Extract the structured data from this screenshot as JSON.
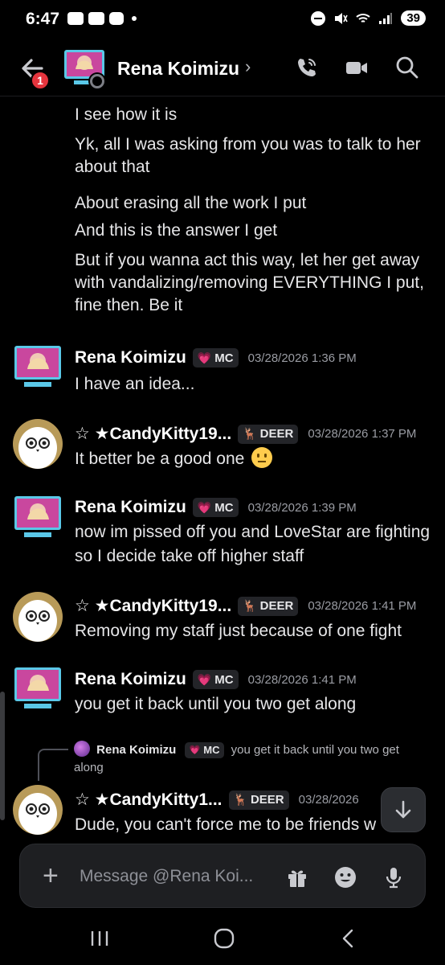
{
  "status_bar": {
    "time": "6:47",
    "battery": "39"
  },
  "header": {
    "back_badge": "1",
    "contact_name": "Rena Koimizu",
    "chevron": "›"
  },
  "chat": {
    "continued_lines": [
      "I see how it is",
      "Yk, all I was asking from you was to talk to her about that",
      "About erasing all the work I put",
      "And this is the answer I get",
      "But if you wanna act this way, let her get away with vandalizing/removing EVERYTHING I put, fine then. Be it"
    ],
    "messages": [
      {
        "author": "Rena Koimizu",
        "tag_icon": "💗",
        "tag": "MC",
        "timestamp": "03/28/2026 1:36 PM",
        "text": "I have an idea..."
      },
      {
        "author": "☆ ★CandyKitty19...",
        "tag_icon": "🦌",
        "tag": "DEER",
        "timestamp": "03/28/2026 1:37 PM",
        "text": "It better be a good one"
      },
      {
        "author": "Rena Koimizu",
        "tag_icon": "💗",
        "tag": "MC",
        "timestamp": "03/28/2026 1:39 PM",
        "text": "now im pissed off you and LoveStar are fighting so I decide take off higher staff"
      },
      {
        "author": "☆ ★CandyKitty19...",
        "tag_icon": "🦌",
        "tag": "DEER",
        "timestamp": "03/28/2026 1:41 PM",
        "text": "Removing my staff just because of one fight"
      },
      {
        "author": "Rena Koimizu",
        "tag_icon": "💗",
        "tag": "MC",
        "timestamp": "03/28/2026 1:41 PM",
        "text": "you get it back until you two get along"
      },
      {
        "author": "☆ ★CandyKitty1...",
        "tag_icon": "🦌",
        "tag": "DEER",
        "timestamp": "03/28/2026",
        "text": "Dude, you can't force me to be friends w"
      }
    ],
    "reply": {
      "author": "Rena Koimizu",
      "tag_icon": "💗",
      "tag": "MC",
      "text": "you get it back until you two get along"
    }
  },
  "composer": {
    "plus": "+",
    "placeholder": "Message @Rena Koi..."
  },
  "icons": {
    "back": "back-arrow-icon",
    "call": "phone-call-icon",
    "video": "video-camera-icon",
    "search": "search-icon",
    "gift": "gift-icon",
    "emoji": "emoji-icon",
    "mic": "microphone-icon",
    "jump": "arrow-down-icon"
  }
}
